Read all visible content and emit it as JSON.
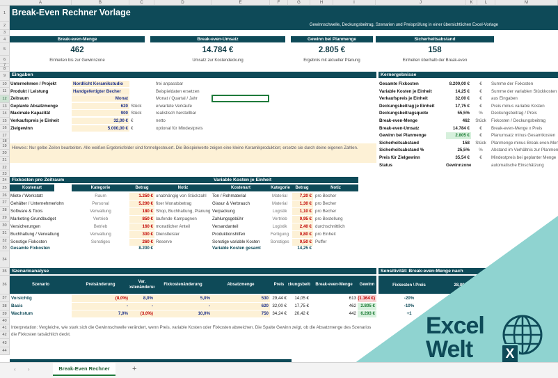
{
  "columns": [
    "A",
    "B",
    "C",
    "D",
    "E",
    "F",
    "G",
    "H",
    "I",
    "J",
    "K",
    "L",
    "M"
  ],
  "rows": [
    "1",
    "2",
    "3",
    "4",
    "5",
    "6",
    "7",
    "8",
    "9",
    "10",
    "11",
    "12",
    "13",
    "14",
    "15",
    "16",
    "17",
    "18",
    "19",
    "20",
    "21",
    "22",
    "23",
    "24",
    "25",
    "26",
    "27",
    "28",
    "29",
    "30",
    "31",
    "32",
    "33",
    "34",
    "35",
    "36",
    "37",
    "38",
    "39",
    "40",
    "41",
    "42",
    "43",
    "44"
  ],
  "title": "Break-Even Rechner Vorlage",
  "subtitle": "Gewinnschwelle, Deckungsbeitrag, Szenarien und Preisprüfung in einer übersichtlichen Excel-Vorlage",
  "kpis": [
    {
      "label": "Break-even-Menge",
      "value": "462",
      "note": "Einheiten bis zur Gewinnzone"
    },
    {
      "label": "Break-even-Umsatz",
      "value": "14.784 €",
      "note": "Umsatz zur Kostendeckung"
    },
    {
      "label": "Gewinn bei Planmenge",
      "value": "2.805 €",
      "note": "Ergebnis mit aktueller Planung"
    },
    {
      "label": "Sicherheitsabstand",
      "value": "158",
      "note": "Einheiten überhalb der Break-even"
    }
  ],
  "inputs": {
    "heading": "Eingaben",
    "rows": [
      {
        "label": "Unternehmen / Projekt",
        "value": "Nordlicht Keramikstudio",
        "unit": "",
        "note": "frei anpassbar",
        "align": "left"
      },
      {
        "label": "Produkt / Leistung",
        "value": "Handgefertigter Becher",
        "unit": "",
        "note": "Beispieldaten ersetzen",
        "align": "left"
      },
      {
        "label": "Zeitraum",
        "value": "Monat",
        "unit": "",
        "note": "Monat / Quartal / Jahr",
        "align": "right"
      },
      {
        "label": "Geplante Absatzmenge",
        "value": "620",
        "unit": "Stück",
        "note": "erwartete Verkäufe",
        "align": "right"
      },
      {
        "label": "Maximale Kapazität",
        "value": "900",
        "unit": "Stück",
        "note": "realistisch herstellbar",
        "align": "right"
      },
      {
        "label": "Verkaufspreis je Einheit",
        "value": "32,00 €",
        "unit": "€",
        "note": "netto",
        "align": "right"
      },
      {
        "label": "Zielgewinn",
        "value": "5.000,00 €",
        "unit": "€",
        "note": "optional für Mindestpreis",
        "align": "right"
      }
    ]
  },
  "hint": "Hinweis: Nur gelbe Zeilen bearbeiten. Alle weißen Ergebnisfelder sind formelgesteuert. Die Beispielwerte zeigen eine kleine Keramikproduktion; ersetze sie durch deine eigenen Zahlen.",
  "results": {
    "heading": "Kernergebnisse",
    "rows": [
      {
        "label": "Gesamte Fixkosten",
        "value": "8.200,00 €",
        "unit": "€",
        "note": "Summe der Fixkosten",
        "style": ""
      },
      {
        "label": "Variable Kosten je Einheit",
        "value": "14,25 €",
        "unit": "€",
        "note": "Summe der variablen Stückkosten",
        "style": ""
      },
      {
        "label": "Verkaufspreis je Einheit",
        "value": "32,00 €",
        "unit": "€",
        "note": "aus Eingaben",
        "style": ""
      },
      {
        "label": "Deckungsbeitrag je Einheit",
        "value": "17,75 €",
        "unit": "€",
        "note": "Preis minus variable Kosten",
        "style": ""
      },
      {
        "label": "Deckungsbeitragsquote",
        "value": "55,5%",
        "unit": "%",
        "note": "Deckungsbeitrag / Preis",
        "style": ""
      },
      {
        "label": "Break-even-Menge",
        "value": "462",
        "unit": "Stück",
        "note": "Fixkosten / Deckungsbeitrag",
        "style": ""
      },
      {
        "label": "Break-even-Umsatz",
        "value": "14.784 €",
        "unit": "€",
        "note": "Break-even-Menge x Preis",
        "style": ""
      },
      {
        "label": "Gewinn bei Planmenge",
        "value": "2.805 €",
        "unit": "€",
        "note": "Planumsatz minus Gesamtkosten",
        "style": "green"
      },
      {
        "label": "Sicherheitsabstand",
        "value": "158",
        "unit": "Stück",
        "note": "Planmenge minus Break-even-Menge",
        "style": ""
      },
      {
        "label": "Sicherheitsabstand %",
        "value": "25,5%",
        "unit": "%",
        "note": "Abstand im Verhältnis zur Planmenge",
        "style": ""
      },
      {
        "label": "Preis für Zielgewinn",
        "value": "35,54 €",
        "unit": "€",
        "note": "Mindestpreis bei geplanter Menge",
        "style": ""
      },
      {
        "label": "Status",
        "value": "Gewinnzone",
        "unit": "",
        "note": "automatische Einschätzung",
        "style": ""
      }
    ]
  },
  "fixed_costs": {
    "heading": "Fixkosten pro Zeitraum",
    "columns": [
      "Kostenart",
      "Kategorie",
      "Betrag",
      "Notiz"
    ],
    "rows": [
      {
        "name": "Miete / Werkstatt",
        "cat": "Raum",
        "amount": "1.250 €",
        "note": "unabhängig von Stückzahl"
      },
      {
        "name": "Gehälter / Unternehmerlohn",
        "cat": "Personal",
        "amount": "5.200 €",
        "note": "fixer Monatsbetrag"
      },
      {
        "name": "Software & Tools",
        "cat": "Verwaltung",
        "amount": "180 €",
        "note": "Shop, Buchhaltung, Planung"
      },
      {
        "name": "Marketing-Grundbudget",
        "cat": "Vertrieb",
        "amount": "850 €",
        "note": "laufende Kampagnen"
      },
      {
        "name": "Versicherungen",
        "cat": "Betrieb",
        "amount": "160 €",
        "note": "monatlicher Anteil"
      },
      {
        "name": "Buchhaltung / Verwaltung",
        "cat": "Verwaltung",
        "amount": "300 €",
        "note": "Dienstleister"
      },
      {
        "name": "Sonstige Fixkosten",
        "cat": "Sonstiges",
        "amount": "260 €",
        "note": "Reserve"
      }
    ],
    "total_label": "Gesamte Fixkosten",
    "total": "8.200 €"
  },
  "variable_costs": {
    "heading": "Variable Kosten je Einheit",
    "columns": [
      "Kostenart",
      "Kategorie",
      "Betrag",
      "Notiz"
    ],
    "rows": [
      {
        "name": "Ton / Rohmaterial",
        "cat": "Material",
        "amount": "7,20 €",
        "note": "pro Becher"
      },
      {
        "name": "Glasur & Verbrauch",
        "cat": "Material",
        "amount": "1,30 €",
        "note": "pro Becher"
      },
      {
        "name": "Verpackung",
        "cat": "Logistik",
        "amount": "1,10 €",
        "note": "pro Becher"
      },
      {
        "name": "Zahlungsgebühr",
        "cat": "Vertrieb",
        "amount": "0,95 €",
        "note": "pro Bestellung"
      },
      {
        "name": "Versandanteil",
        "cat": "Logistik",
        "amount": "2,40 €",
        "note": "durchschnittlich"
      },
      {
        "name": "Produktionshilfen",
        "cat": "Fertigung",
        "amount": "0,80 €",
        "note": "pro Einheit"
      },
      {
        "name": "Sonstige variable Kosten",
        "cat": "Sonstiges",
        "amount": "0,50 €",
        "note": "Puffer"
      }
    ],
    "total_label": "Variable Kosten gesamt",
    "total": "14,25 €"
  },
  "scenario": {
    "heading": "Szenarioanalyse",
    "columns": [
      "Szenario",
      "Preisänderung",
      "Var. Kostenänderung",
      "Fixkostenänderung",
      "Absatzmenge",
      "Preis",
      "Deckungsbeitrag",
      "Break-even-Menge",
      "Gewinn"
    ],
    "rows": [
      {
        "name": "Vorsichtig",
        "price_chg": "(8,0%)",
        "var_chg": "8,0%",
        "fix_chg": "5,0%",
        "qty": "530",
        "price": "29,44 €",
        "db": "14,05 €",
        "be": "613",
        "profit": "(1.164 €)",
        "profit_style": "red"
      },
      {
        "name": "Basis",
        "price_chg": "-",
        "var_chg": "-",
        "fix_chg": "-",
        "qty": "620",
        "price": "32,00 €",
        "db": "17,75 €",
        "be": "462",
        "profit": "2.805 €",
        "profit_style": "green"
      },
      {
        "name": "Wachstum",
        "price_chg": "7,0%",
        "var_chg": "(3,0%)",
        "fix_chg": "10,0%",
        "qty": "750",
        "price": "34,24 €",
        "db": "20,42 €",
        "be": "442",
        "profit": "6.293 €",
        "profit_style": "green"
      }
    ],
    "interpretation": "Interpretation: Vergleiche, wie stark sich die Gewinnschwelle verändert, wenn Preis, variable Kosten oder Fixkosten abweichen. Die Spalte Gewinn zeigt, ob die Absatzmenge des Szenarios die Fixkosten tatsächlich deckt."
  },
  "sensitivity": {
    "heading": "Sensitivität: Break-even-Menge nach",
    "columns": [
      "Fixkosten \\ Preis",
      "28,80"
    ],
    "rows": [
      "-20%",
      "-10%",
      "+1"
    ]
  },
  "logo": {
    "line1": "Excel",
    "line2": "Welt",
    "badge": "X"
  },
  "sheet_tab": "Break-Even Rechner",
  "colors": {
    "header": "#0e4a58",
    "input_bg": "#fdf1d6",
    "teal": "#8fd3d0",
    "logo_dark": "#0e4a58"
  }
}
